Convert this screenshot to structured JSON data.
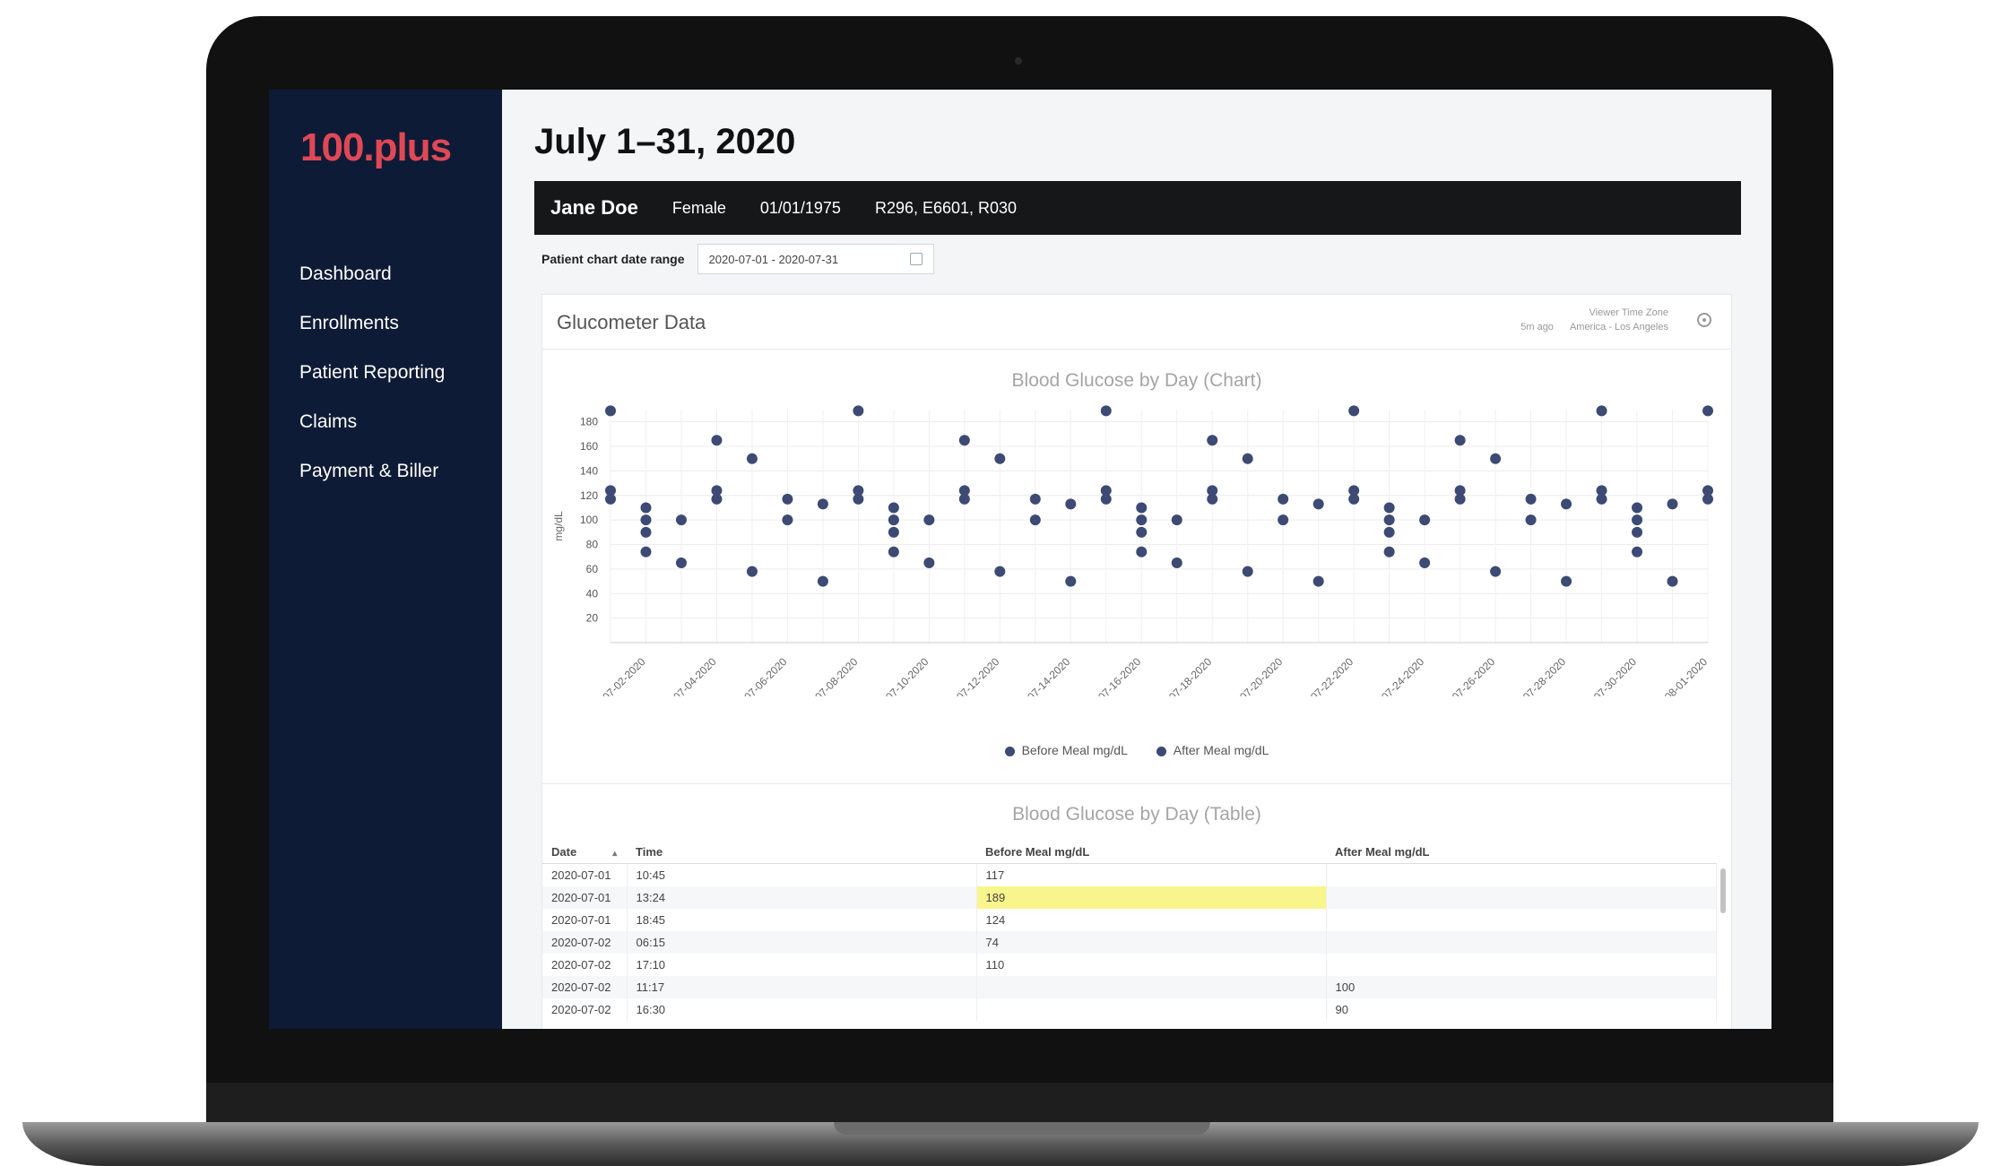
{
  "app": {
    "logo": "100.plus"
  },
  "sidebar": {
    "items": [
      {
        "label": "Dashboard"
      },
      {
        "label": "Enrollments"
      },
      {
        "label": "Patient Reporting"
      },
      {
        "label": "Claims"
      },
      {
        "label": "Payment & Biller"
      }
    ]
  },
  "page": {
    "title": "July 1–31, 2020"
  },
  "patient": {
    "name": "Jane Doe",
    "sex": "Female",
    "dob": "01/01/1975",
    "codes": "R296, E6601, R030"
  },
  "date_range": {
    "label": "Patient chart date range",
    "value": "2020-07-01 - 2020-07-31"
  },
  "card": {
    "title": "Glucometer Data",
    "updated": "5m ago",
    "tz_label": "Viewer Time Zone",
    "tz_value": "America - Los Angeles"
  },
  "colors": {
    "sidebar_bg": "#0e1b36",
    "logo": "#e04855",
    "marker": "#3c4a74",
    "highlight": "#f8f58c"
  },
  "chart_data": {
    "type": "scatter",
    "title": "Blood Glucose by Day (Chart)",
    "xlabel": "",
    "ylabel": "mg/dL",
    "ylim": [
      0,
      190
    ],
    "yticks": [
      20,
      40,
      60,
      80,
      100,
      120,
      140,
      160,
      180
    ],
    "x_ticks": [
      "07-02-2020",
      "07-04-2020",
      "07-06-2020",
      "07-08-2020",
      "07-10-2020",
      "07-12-2020",
      "07-14-2020",
      "07-16-2020",
      "07-18-2020",
      "07-20-2020",
      "07-22-2020",
      "07-24-2020",
      "07-26-2020",
      "07-28-2020",
      "07-30-2020",
      "08-01-2020"
    ],
    "grid": true,
    "series": [
      {
        "name": "Before Meal mg/dL",
        "points": [
          [
            "07-01-2020",
            117
          ],
          [
            "07-01-2020",
            189
          ],
          [
            "07-01-2020",
            124
          ],
          [
            "07-02-2020",
            74
          ],
          [
            "07-02-2020",
            110
          ],
          [
            "07-03-2020",
            100
          ],
          [
            "07-04-2020",
            117
          ],
          [
            "07-04-2020",
            124
          ],
          [
            "07-05-2020",
            58
          ],
          [
            "07-06-2020",
            117
          ],
          [
            "07-07-2020",
            113
          ],
          [
            "07-08-2020",
            117
          ],
          [
            "07-08-2020",
            124
          ],
          [
            "07-08-2020",
            189
          ],
          [
            "07-09-2020",
            74
          ],
          [
            "07-09-2020",
            110
          ],
          [
            "07-10-2020",
            100
          ],
          [
            "07-11-2020",
            117
          ],
          [
            "07-11-2020",
            124
          ],
          [
            "07-12-2020",
            58
          ],
          [
            "07-13-2020",
            117
          ],
          [
            "07-14-2020",
            113
          ],
          [
            "07-15-2020",
            117
          ],
          [
            "07-15-2020",
            124
          ],
          [
            "07-15-2020",
            189
          ],
          [
            "07-16-2020",
            74
          ],
          [
            "07-16-2020",
            110
          ],
          [
            "07-17-2020",
            100
          ],
          [
            "07-18-2020",
            117
          ],
          [
            "07-18-2020",
            124
          ],
          [
            "07-19-2020",
            58
          ],
          [
            "07-20-2020",
            117
          ],
          [
            "07-21-2020",
            113
          ],
          [
            "07-22-2020",
            117
          ],
          [
            "07-22-2020",
            124
          ],
          [
            "07-22-2020",
            189
          ],
          [
            "07-23-2020",
            74
          ],
          [
            "07-23-2020",
            110
          ],
          [
            "07-24-2020",
            100
          ],
          [
            "07-25-2020",
            117
          ],
          [
            "07-25-2020",
            124
          ],
          [
            "07-26-2020",
            58
          ],
          [
            "07-27-2020",
            117
          ],
          [
            "07-28-2020",
            113
          ],
          [
            "07-29-2020",
            117
          ],
          [
            "07-29-2020",
            124
          ],
          [
            "07-29-2020",
            189
          ],
          [
            "07-30-2020",
            74
          ],
          [
            "07-30-2020",
            110
          ],
          [
            "07-31-2020",
            113
          ],
          [
            "08-01-2020",
            117
          ],
          [
            "08-01-2020",
            124
          ],
          [
            "08-01-2020",
            189
          ]
        ]
      },
      {
        "name": "After Meal mg/dL",
        "points": [
          [
            "07-02-2020",
            100
          ],
          [
            "07-02-2020",
            90
          ],
          [
            "07-03-2020",
            65
          ],
          [
            "07-04-2020",
            165
          ],
          [
            "07-05-2020",
            150
          ],
          [
            "07-06-2020",
            100
          ],
          [
            "07-07-2020",
            50
          ],
          [
            "07-09-2020",
            100
          ],
          [
            "07-09-2020",
            90
          ],
          [
            "07-10-2020",
            65
          ],
          [
            "07-11-2020",
            165
          ],
          [
            "07-12-2020",
            150
          ],
          [
            "07-13-2020",
            100
          ],
          [
            "07-14-2020",
            50
          ],
          [
            "07-16-2020",
            100
          ],
          [
            "07-16-2020",
            90
          ],
          [
            "07-17-2020",
            65
          ],
          [
            "07-18-2020",
            165
          ],
          [
            "07-19-2020",
            150
          ],
          [
            "07-20-2020",
            100
          ],
          [
            "07-21-2020",
            50
          ],
          [
            "07-23-2020",
            100
          ],
          [
            "07-23-2020",
            90
          ],
          [
            "07-24-2020",
            65
          ],
          [
            "07-25-2020",
            165
          ],
          [
            "07-26-2020",
            150
          ],
          [
            "07-27-2020",
            100
          ],
          [
            "07-28-2020",
            50
          ],
          [
            "07-30-2020",
            100
          ],
          [
            "07-30-2020",
            90
          ],
          [
            "07-31-2020",
            50
          ]
        ]
      }
    ]
  },
  "table": {
    "title": "Blood Glucose by Day (Table)",
    "columns": [
      "Date",
      "Time",
      "Before Meal mg/dL",
      "After Meal mg/dL"
    ],
    "rows": [
      [
        "2020-07-01",
        "10:45",
        "117",
        ""
      ],
      [
        "2020-07-01",
        "13:24",
        "189",
        ""
      ],
      [
        "2020-07-01",
        "18:45",
        "124",
        ""
      ],
      [
        "2020-07-02",
        "06:15",
        "74",
        ""
      ],
      [
        "2020-07-02",
        "17:10",
        "110",
        ""
      ],
      [
        "2020-07-02",
        "11:17",
        "",
        "100"
      ],
      [
        "2020-07-02",
        "16:30",
        "",
        "90"
      ]
    ]
  }
}
